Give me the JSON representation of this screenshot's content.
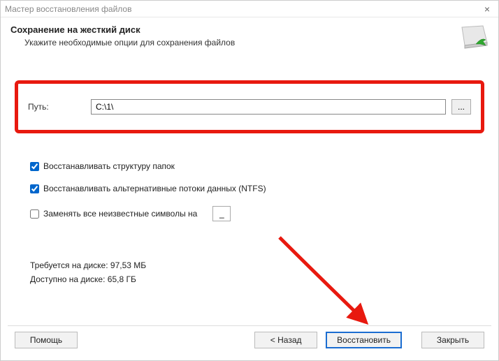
{
  "window": {
    "title": "Мастер восстановления файлов"
  },
  "header": {
    "title": "Сохранение на жесткий диск",
    "subtitle": "Укажите необходимые опции для сохранения файлов"
  },
  "path": {
    "label": "Путь:",
    "value": "C:\\1\\",
    "browse": "..."
  },
  "options": {
    "restore_folder_structure": {
      "label": "Восстанавливать структуру папок",
      "checked": true
    },
    "restore_alt_streams": {
      "label": "Восстанавливать альтернативные потоки данных (NTFS)",
      "checked": true
    },
    "replace_unknown_chars": {
      "label": "Заменять все неизвестные символы на",
      "checked": false,
      "value": "_"
    }
  },
  "disk": {
    "required_label": "Требуется на диске:",
    "required_value": "97,53 МБ",
    "available_label": "Доступно на диске:",
    "available_value": "65,8 ГБ"
  },
  "buttons": {
    "help": "Помощь",
    "back": "< Назад",
    "recover": "Восстановить",
    "close": "Закрыть"
  },
  "annotations": {
    "highlight_color": "#e8190f",
    "arrow_color": "#e8190f"
  }
}
